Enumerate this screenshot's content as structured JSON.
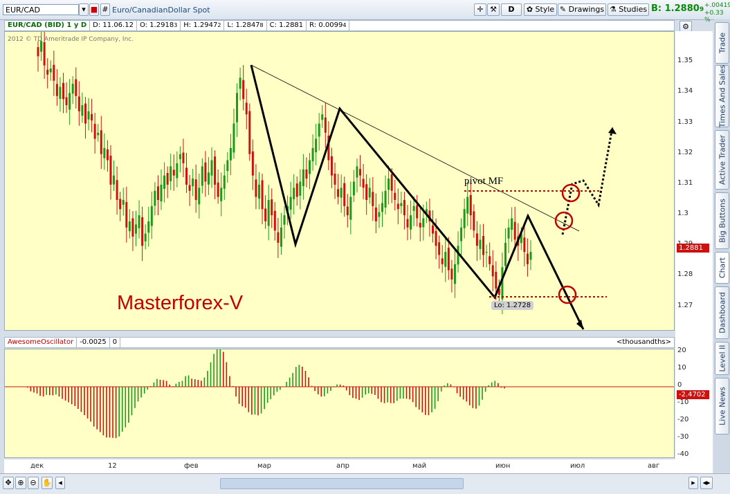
{
  "toolbar": {
    "symbol": "EUR/CAD",
    "description": "Euro/CanadianDollar Spot",
    "d_label": "D",
    "style_label": "Style",
    "drawings_label": "Drawings",
    "studies_label": "Studies",
    "bid": "B: 1.2880",
    "bid_small": "9",
    "change_abs": "+.00419",
    "change_pct": "+0.33 %"
  },
  "info": {
    "title": "EUR/CAD (BID) 1 y D",
    "date": "D: 11.06.12",
    "open": "O: 1.2918",
    "open_s": "3",
    "high": "H: 1.2947",
    "high_s": "2",
    "low": "L: 1.2847",
    "low_s": "8",
    "close": "C: 1.2881",
    "range": "R: 0.0099",
    "range_s": "4"
  },
  "copyright": "2012 © TD Ameritrade IP Company, Inc.",
  "oscillator": {
    "name": "AwesomeOscillator",
    "value": "-0.0025",
    "zero": "0",
    "unit": "<thousandths>",
    "price_tag": "-2.4702"
  },
  "side_tabs": [
    "Trade",
    "Times And Sales",
    "Active Trader",
    "Big Buttons",
    "Chart",
    "Dashboard",
    "Level II",
    "Live News"
  ],
  "chart_data": {
    "type": "candlestick",
    "ylim": [
      1.262,
      1.36
    ],
    "yticks": [
      "1.35",
      "1.34",
      "1.33",
      "1.32",
      "1.31",
      "1.3",
      "1.29",
      "1.28",
      "1.27"
    ],
    "xticks": [
      "дек",
      "12",
      "фев",
      "мар",
      "апр",
      "май",
      "июн",
      "июл",
      "авг"
    ],
    "current_price": "1.2881",
    "annotations": {
      "watermark": "Masterforex-V",
      "pivot": "pivot MF",
      "low_label": "Lo: 1.2728"
    },
    "closes": [
      1.352,
      1.357,
      1.349,
      1.346,
      1.348,
      1.344,
      1.339,
      1.342,
      1.338,
      1.336,
      1.34,
      1.343,
      1.339,
      1.334,
      1.336,
      1.33,
      1.334,
      1.331,
      1.325,
      1.327,
      1.32,
      1.322,
      1.318,
      1.31,
      1.313,
      1.305,
      1.302,
      1.305,
      1.296,
      1.298,
      1.293,
      1.297,
      1.3,
      1.29,
      1.294,
      1.298,
      1.303,
      1.308,
      1.305,
      1.31,
      1.313,
      1.31,
      1.316,
      1.313,
      1.317,
      1.32,
      1.317,
      1.31,
      1.308,
      1.312,
      1.305,
      1.309,
      1.316,
      1.311,
      1.314,
      1.318,
      1.31,
      1.306,
      1.309,
      1.313,
      1.318,
      1.322,
      1.33,
      1.34,
      1.345,
      1.338,
      1.333,
      1.32,
      1.313,
      1.306,
      1.31,
      1.302,
      1.298,
      1.305,
      1.3,
      1.295,
      1.291,
      1.296,
      1.3,
      1.303,
      1.306,
      1.309,
      1.306,
      1.311,
      1.315,
      1.312,
      1.318,
      1.322,
      1.325,
      1.33,
      1.333,
      1.327,
      1.318,
      1.313,
      1.31,
      1.306,
      1.309,
      1.303,
      1.3,
      1.306,
      1.311,
      1.316,
      1.313,
      1.309,
      1.305,
      1.309,
      1.303,
      1.298,
      1.301,
      1.304,
      1.308,
      1.312,
      1.308,
      1.305,
      1.302,
      1.304,
      1.3,
      1.296,
      1.3,
      1.303,
      1.299,
      1.296,
      1.299,
      1.302,
      1.298,
      1.294,
      1.29,
      1.287,
      1.284,
      1.288,
      1.282,
      1.279,
      1.284,
      1.29,
      1.296,
      1.302,
      1.306,
      1.3,
      1.295,
      1.29,
      1.292,
      1.287,
      1.288,
      1.284,
      1.28,
      1.276,
      1.274,
      1.283,
      1.291,
      1.296,
      1.299,
      1.292,
      1.29,
      1.294,
      1.288,
      1.284,
      1.288
    ],
    "oscillator_range": [
      -40,
      20
    ],
    "oscillator_ticks": [
      "20",
      "10",
      "0",
      "-10",
      "-20",
      "-30",
      "-40"
    ]
  },
  "colors": {
    "up": "#1a9a1a",
    "down": "#cc1111",
    "plot_bg": "#ffffc6",
    "annot": "#c00000"
  }
}
